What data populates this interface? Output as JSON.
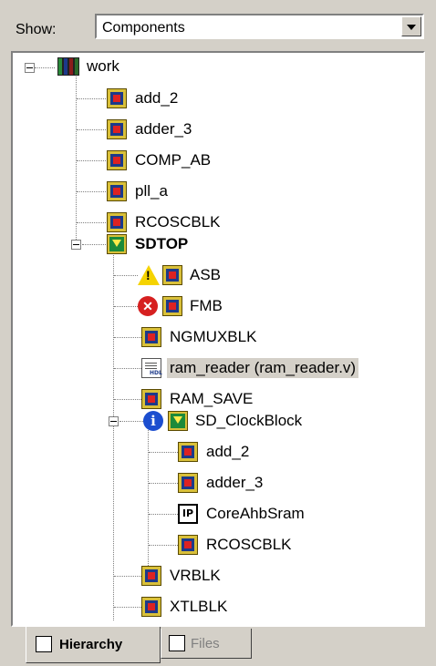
{
  "show": {
    "label": "Show:",
    "value": "Components"
  },
  "tree": {
    "root": {
      "label": "work",
      "icon": "library-books-icon"
    },
    "items": [
      {
        "label": "add_2"
      },
      {
        "label": "adder_3"
      },
      {
        "label": "COMP_AB"
      },
      {
        "label": "pll_a"
      },
      {
        "label": "RCOSCBLK"
      },
      {
        "label": "SDTOP"
      },
      {
        "label": "ASB",
        "status": "warning"
      },
      {
        "label": "FMB",
        "status": "error"
      },
      {
        "label": "NGMUXBLK"
      },
      {
        "label": "ram_reader (ram_reader.v)"
      },
      {
        "label": "RAM_SAVE"
      },
      {
        "label": "SD_ClockBlock",
        "status": "info"
      },
      {
        "label": "add_2"
      },
      {
        "label": "adder_3"
      },
      {
        "label": "CoreAhbSram",
        "icon_text": "IP"
      },
      {
        "label": "RCOSCBLK"
      },
      {
        "label": "VRBLK"
      },
      {
        "label": "XTLBLK"
      }
    ]
  },
  "tabs": [
    {
      "label": "Hierarchy"
    },
    {
      "label": "Files"
    }
  ]
}
